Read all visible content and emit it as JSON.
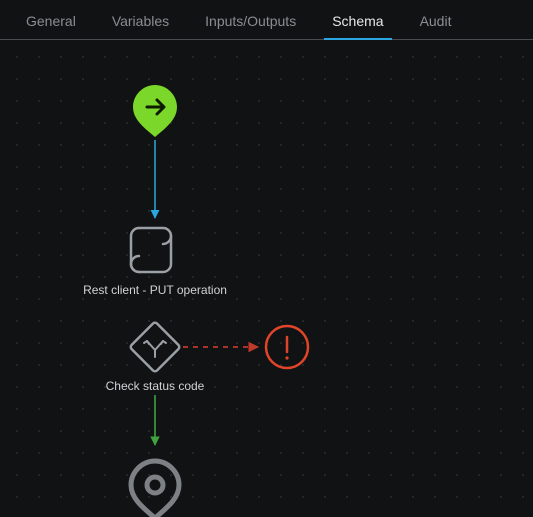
{
  "tabs": {
    "items": [
      {
        "label": "General",
        "active": false
      },
      {
        "label": "Variables",
        "active": false
      },
      {
        "label": "Inputs/Outputs",
        "active": false
      },
      {
        "label": "Schema",
        "active": true
      },
      {
        "label": "Audit",
        "active": false
      }
    ]
  },
  "workflow": {
    "nodes": {
      "start": {
        "type": "start"
      },
      "rest_put": {
        "type": "script",
        "label": "Rest client - PUT operation"
      },
      "check_status": {
        "type": "decision",
        "label": "Check status code"
      },
      "error": {
        "type": "error"
      },
      "end": {
        "type": "end"
      }
    }
  },
  "colors": {
    "accent": "#2aa7e0",
    "start": "#7bd72a",
    "error": "#e0452a",
    "icon": "#9aa0a5",
    "success_edge": "#3fa23f",
    "fail_edge": "#c0392b",
    "flow_edge": "#2aa7e0"
  }
}
